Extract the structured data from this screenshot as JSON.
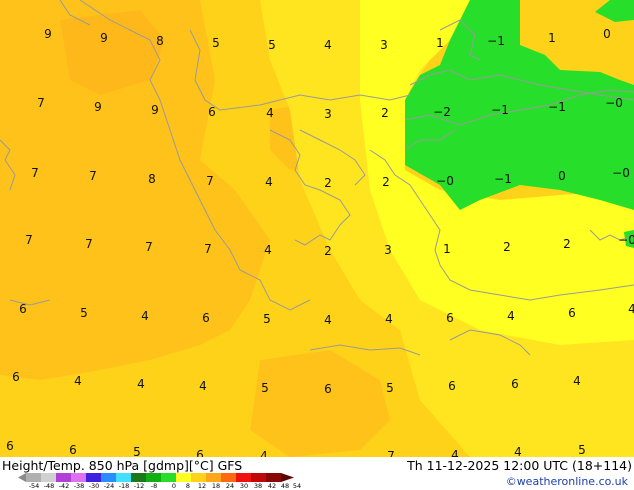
{
  "map": {
    "values": [
      "9",
      "9",
      "8",
      "5",
      "5",
      "4",
      "3",
      "1",
      "−1",
      "1",
      "0",
      "7",
      "9",
      "9",
      "6",
      "4",
      "3",
      "2",
      "−2",
      "−1",
      "−1",
      "−0",
      "7",
      "7",
      "8",
      "7",
      "4",
      "2",
      "2",
      "−0",
      "−1",
      "0",
      "−0",
      "7",
      "7",
      "7",
      "7",
      "4",
      "2",
      "3",
      "1",
      "2",
      "2",
      "−0",
      "6",
      "5",
      "4",
      "6",
      "5",
      "4",
      "4",
      "6",
      "4",
      "6",
      "4",
      "6",
      "4",
      "4",
      "4",
      "5",
      "6",
      "5",
      "6",
      "6",
      "4",
      "6",
      "6",
      "5",
      "6",
      "4",
      "7",
      "4",
      "4",
      "5"
    ],
    "colors": {
      "ocean_fill": "#ffd21a",
      "warm_fill": "#ffc21a",
      "cool_fill": "#ffe51f",
      "bright_fill": "#ffff22",
      "green_fill": "#27de2a",
      "coastline": "#9a9a9a"
    }
  },
  "footer": {
    "title": "Height/Temp. 850 hPa [gdmp][°C] GFS",
    "datetime": "Th 11-12-2025 12:00 UTC (18+114)",
    "credit": "©weatheronline.co.uk",
    "colorbar_ticks": [
      "-54",
      "-48",
      "-42",
      "-38",
      "-30",
      "-24",
      "-18",
      "-12",
      "-8",
      "0",
      "8",
      "12",
      "18",
      "24",
      "30",
      "38",
      "42",
      "48",
      "54"
    ]
  }
}
